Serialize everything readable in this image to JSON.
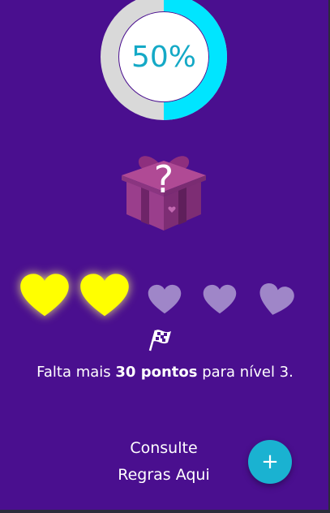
{
  "progress": {
    "percent": 50,
    "label": "50%",
    "ring_track_color": "#d9d9d9",
    "ring_fill_color": "#00e5ff",
    "text_color": "#14a9c6"
  },
  "reward": {
    "icon": "gift-box-icon",
    "mark": "?"
  },
  "level": {
    "hearts_total": 5,
    "hearts_filled": 2,
    "heart_filled_color": "#ffff00",
    "heart_empty_color": "#9f86c8",
    "goal_icon": "checkered-flag-icon",
    "prefix": "Falta mais",
    "points": "30 pontos",
    "suffix": "para nível 3."
  },
  "rules": {
    "line1": "Consulte",
    "line2": "Regras Aqui",
    "fab_icon": "plus-icon",
    "fab_glyph": "+",
    "fab_color": "#1ab2d1"
  },
  "background_color": "#4a0f8f"
}
